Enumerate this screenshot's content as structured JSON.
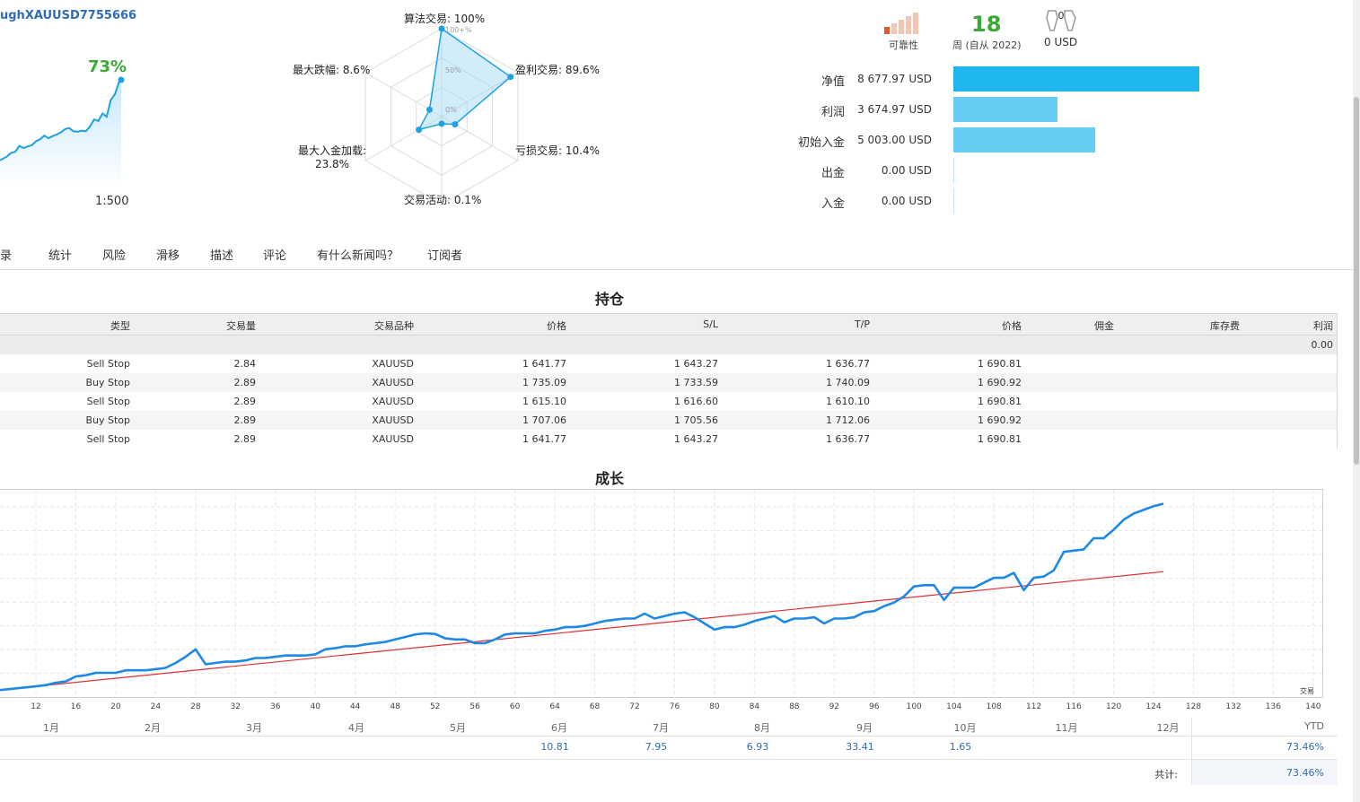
{
  "header": {
    "account_name": "ughXAUUSD7755666",
    "growth_percent": "73%",
    "leverage": "1:500"
  },
  "radar": {
    "labels": {
      "algo": "算法交易: 100%",
      "profit_trades": "盈利交易: 89.6%",
      "loss_trades": "亏损交易: 10.4%",
      "activity": "交易活动: 0.1%",
      "max_deposit_load_line1": "最大入金加载:",
      "max_deposit_load_line2": "23.8%",
      "max_drawdown": "最大跌幅: 8.6%"
    },
    "scale": {
      "top": "100+%",
      "mid": "50%",
      "low": "0%"
    },
    "values": [
      100,
      89.6,
      10.4,
      0.1,
      23.8,
      8.6
    ]
  },
  "stats": {
    "reliability_label": "可靠性",
    "weeks_value": "18",
    "weeks_label": "周 (自从 2022)",
    "subscribers_icon_value": "0",
    "subscribers_value": "0 USD",
    "colors": {
      "reliability_active": "#e8582f",
      "reliability_inactive": "#f7c3b3"
    }
  },
  "finance": {
    "rows": [
      {
        "label": "净值",
        "value": "8 677.97 USD",
        "amount": 8677.97,
        "color": "#1fb6ee"
      },
      {
        "label": "利润",
        "value": "3 674.97 USD",
        "amount": 3674.97,
        "color": "#64cdf3"
      },
      {
        "label": "初始入金",
        "value": "5 003.00 USD",
        "amount": 5003.0,
        "color": "#64cdf3"
      },
      {
        "label": "出金",
        "value": "0.00 USD",
        "amount": 0,
        "color": "#64cdf3"
      },
      {
        "label": "入金",
        "value": "0.00 USD",
        "amount": 0,
        "color": "#64cdf3"
      }
    ]
  },
  "tabs": [
    "记录",
    "统计",
    "风险",
    "滑移",
    "描述",
    "评论",
    "有什么新闻吗？",
    "订阅者"
  ],
  "positions": {
    "title": "持仓",
    "columns": [
      "类型",
      "交易量",
      "交易品种",
      "价格",
      "S/L",
      "T/P",
      "价格",
      "佣金",
      "库存费",
      "利润"
    ],
    "summary_profit": "0.00",
    "rows": [
      [
        "Sell Stop",
        "2.84",
        "XAUUSD",
        "1 641.77",
        "1 643.27",
        "1 636.77",
        "1 690.81",
        "",
        "",
        ""
      ],
      [
        "Buy Stop",
        "2.89",
        "XAUUSD",
        "1 735.09",
        "1 733.59",
        "1 740.09",
        "1 690.92",
        "",
        "",
        ""
      ],
      [
        "Sell Stop",
        "2.89",
        "XAUUSD",
        "1 615.10",
        "1 616.60",
        "1 610.10",
        "1 690.81",
        "",
        "",
        ""
      ],
      [
        "Buy Stop",
        "2.89",
        "XAUUSD",
        "1 707.06",
        "1 705.56",
        "1 712.06",
        "1 690.92",
        "",
        "",
        ""
      ],
      [
        "Sell Stop",
        "2.89",
        "XAUUSD",
        "1 641.77",
        "1 643.27",
        "1 636.77",
        "1 690.81",
        "",
        "",
        ""
      ]
    ]
  },
  "growth": {
    "title": "成长",
    "axis_note": "交易",
    "xticks": [
      "12",
      "16",
      "20",
      "24",
      "28",
      "32",
      "36",
      "40",
      "44",
      "48",
      "52",
      "56",
      "60",
      "64",
      "68",
      "72",
      "76",
      "80",
      "84",
      "88",
      "92",
      "96",
      "100",
      "104",
      "108",
      "112",
      "116",
      "120",
      "124",
      "128",
      "132",
      "136",
      "140"
    ],
    "months": [
      "1月",
      "2月",
      "3月",
      "4月",
      "5月",
      "6月",
      "7月",
      "8月",
      "9月",
      "10月",
      "11月",
      "12月"
    ],
    "monthly_values": [
      "",
      "",
      "",
      "",
      "",
      "10.81",
      "7.95",
      "6.93",
      "33.41",
      "1.65",
      "",
      ""
    ],
    "ytd_label": "YTD",
    "ytd_value": "73.46%",
    "total_label": "共计:",
    "total_value": "73.46%"
  },
  "chart_data": {
    "type": "line",
    "x_label": "交易",
    "xlim": [
      8.4,
      141
    ],
    "series": [
      {
        "x": [
          8.4,
          12,
          13,
          14,
          15,
          16,
          17,
          18,
          19,
          20,
          21,
          22,
          23,
          24,
          25,
          26,
          27,
          28,
          29,
          30,
          31,
          32,
          33,
          34,
          35,
          36,
          37,
          38,
          39,
          40,
          41,
          42,
          43,
          44,
          45,
          46,
          47,
          48,
          49,
          50,
          51,
          52,
          53,
          54,
          55,
          56,
          57,
          58,
          59,
          60,
          61,
          62,
          63,
          64,
          65,
          66,
          67,
          68,
          69,
          70,
          71,
          72,
          73,
          74,
          75,
          76,
          77,
          78,
          79,
          80,
          81,
          82,
          83,
          84,
          85,
          86,
          87,
          88,
          89,
          90,
          91,
          92,
          93,
          94,
          95,
          96,
          97,
          98,
          99,
          100,
          101,
          102,
          103,
          104,
          105,
          106,
          107,
          108,
          109,
          110,
          111,
          112,
          113,
          114,
          115,
          116,
          117,
          118,
          119,
          120,
          121,
          122,
          123,
          124,
          125
        ],
        "y": [
          0.4,
          1.0,
          1.2,
          1.6,
          1.8,
          2.6,
          2.8,
          3.2,
          3.2,
          3.2,
          3.6,
          3.6,
          3.6,
          3.8,
          4.0,
          4.8,
          5.8,
          7.0,
          4.6,
          4.8,
          5.0,
          5.0,
          5.2,
          5.6,
          5.6,
          5.8,
          6.0,
          6.0,
          6.0,
          6.2,
          7.0,
          7.2,
          7.5,
          7.5,
          7.8,
          8.0,
          8.2,
          8.6,
          9.0,
          9.4,
          9.6,
          9.5,
          8.8,
          8.6,
          8.6,
          8.0,
          8.0,
          8.6,
          9.4,
          9.6,
          9.6,
          9.6,
          10.0,
          10.2,
          10.6,
          10.6,
          10.8,
          11.2,
          11.6,
          11.8,
          12.0,
          12.0,
          12.8,
          12.0,
          12.4,
          12.8,
          13.0,
          12.2,
          11.2,
          10.2,
          10.6,
          10.6,
          11.0,
          11.6,
          12.0,
          12.4,
          11.4,
          12.0,
          12.0,
          12.2,
          11.2,
          12.0,
          12.0,
          12.2,
          13.0,
          13.2,
          14.0,
          14.6,
          15.6,
          17.2,
          17.4,
          17.4,
          15.0,
          17.0,
          17.0,
          17.0,
          17.8,
          18.6,
          18.6,
          19.4,
          16.6,
          18.6,
          18.8,
          19.8,
          22.8,
          23.0,
          23.2,
          25.0,
          25.0,
          26.4,
          28.0,
          29.0,
          29.6,
          30.2,
          30.6
        ]
      },
      {
        "x": [
          8.4,
          125
        ],
        "y": [
          0.4,
          19.6
        ]
      }
    ],
    "colors": [
      "#1e88e5",
      "#e03030"
    ]
  }
}
